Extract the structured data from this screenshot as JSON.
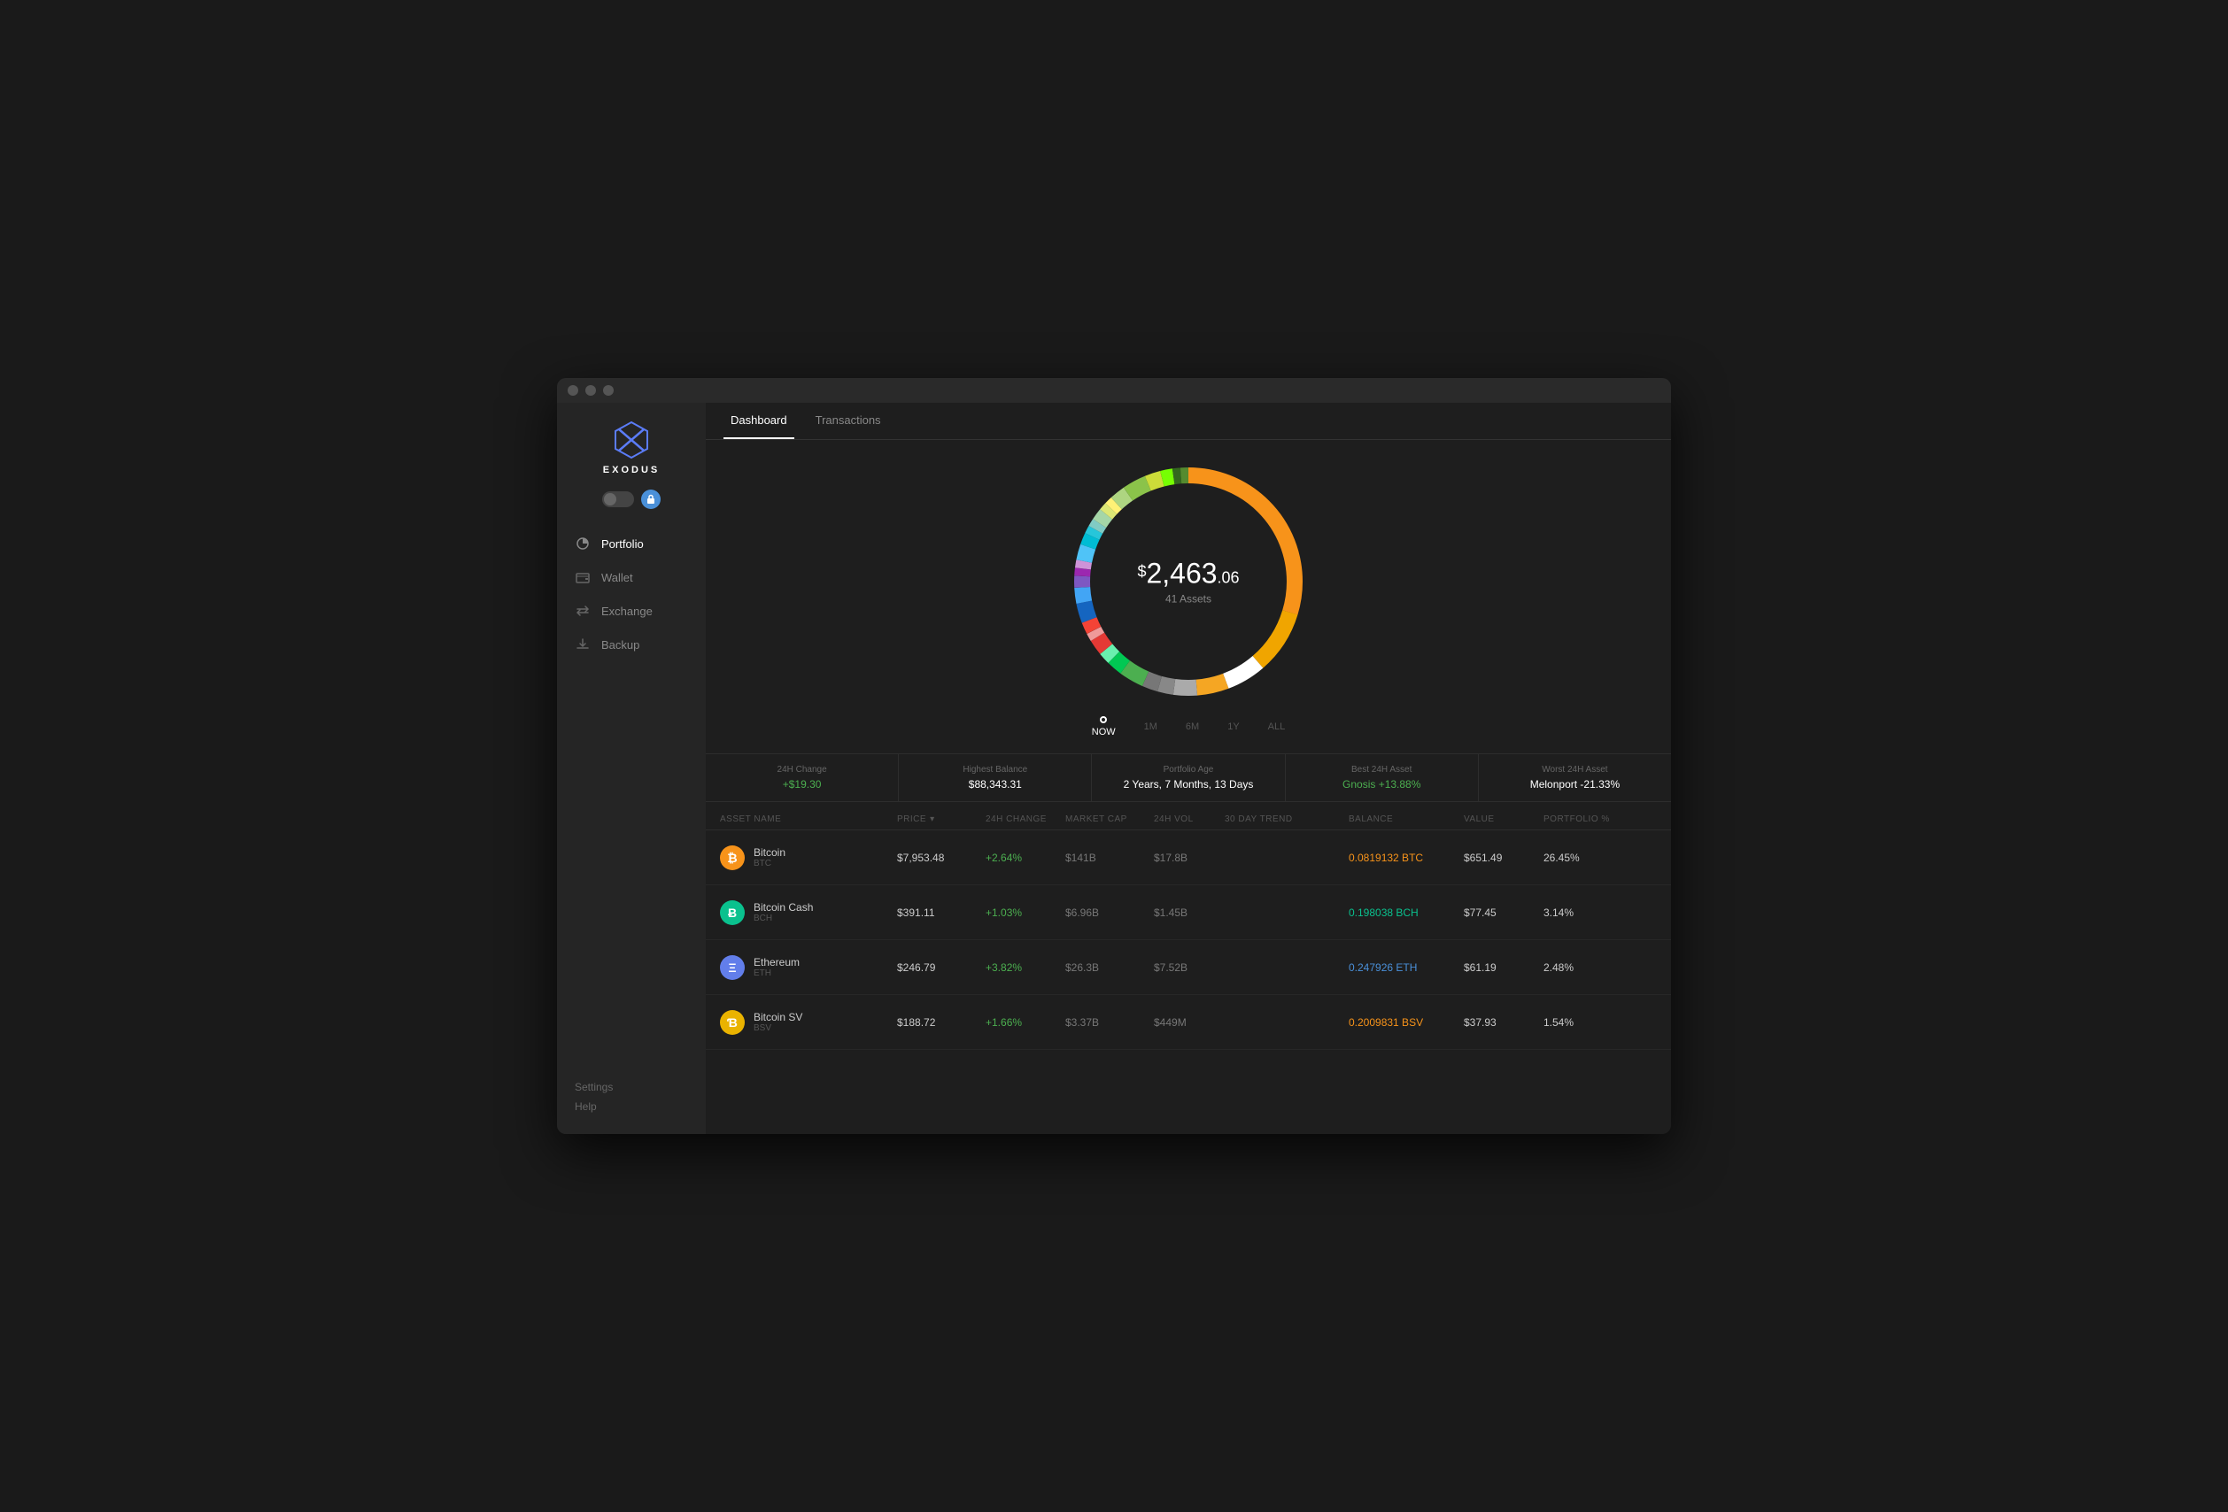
{
  "app": {
    "title": "EXODUS"
  },
  "tabs": [
    {
      "id": "dashboard",
      "label": "Dashboard",
      "active": true
    },
    {
      "id": "transactions",
      "label": "Transactions",
      "active": false
    }
  ],
  "sidebar": {
    "nav_items": [
      {
        "id": "portfolio",
        "label": "Portfolio",
        "active": true,
        "icon": "pie-chart-icon"
      },
      {
        "id": "wallet",
        "label": "Wallet",
        "active": false,
        "icon": "wallet-icon"
      },
      {
        "id": "exchange",
        "label": "Exchange",
        "active": false,
        "icon": "exchange-icon"
      },
      {
        "id": "backup",
        "label": "Backup",
        "active": false,
        "icon": "backup-icon"
      }
    ],
    "settings_label": "Settings",
    "help_label": "Help"
  },
  "portfolio": {
    "total_value": "2,463",
    "total_cents": ".06",
    "dollar_sign": "$",
    "assets_count": "41 Assets",
    "time_options": [
      {
        "id": "now",
        "label": "NOW",
        "active": true
      },
      {
        "id": "1m",
        "label": "1M",
        "active": false
      },
      {
        "id": "6m",
        "label": "6M",
        "active": false
      },
      {
        "id": "1y",
        "label": "1Y",
        "active": false
      },
      {
        "id": "all",
        "label": "ALL",
        "active": false
      }
    ]
  },
  "stats": [
    {
      "label": "24H Change",
      "value": "+$19.30",
      "positive": true
    },
    {
      "label": "Highest Balance",
      "value": "$88,343.31",
      "positive": false
    },
    {
      "label": "Portfolio Age",
      "value": "2 Years, 7 Months, 13 Days",
      "positive": false
    },
    {
      "label": "Best 24H Asset",
      "value": "Gnosis +13.88%",
      "positive": true
    },
    {
      "label": "Worst 24H Asset",
      "value": "Melonport -21.33%",
      "positive": false
    }
  ],
  "table_headers": [
    {
      "id": "name",
      "label": "ASSET NAME"
    },
    {
      "id": "price",
      "label": "PRICE",
      "sortable": true
    },
    {
      "id": "change",
      "label": "24H CHANGE"
    },
    {
      "id": "market_cap",
      "label": "MARKET CAP"
    },
    {
      "id": "vol",
      "label": "24H VOL"
    },
    {
      "id": "trend",
      "label": "30 DAY TREND"
    },
    {
      "id": "balance",
      "label": "BALANCE"
    },
    {
      "id": "value",
      "label": "VALUE"
    },
    {
      "id": "portfolio",
      "label": "PORTFOLIO %"
    }
  ],
  "assets": [
    {
      "name": "Bitcoin",
      "ticker": "BTC",
      "price": "$7,953.48",
      "change": "+2.64%",
      "change_positive": true,
      "market_cap": "$141B",
      "vol": "$17.8B",
      "balance": "0.0819132 BTC",
      "balance_color": "orange",
      "value": "$651.49",
      "portfolio": "26.45%",
      "icon_color": "#f7931a",
      "icon_letter": "₿"
    },
    {
      "name": "Bitcoin Cash",
      "ticker": "BCH",
      "price": "$391.11",
      "change": "+1.03%",
      "change_positive": true,
      "market_cap": "$6.96B",
      "vol": "$1.45B",
      "balance": "0.198038 BCH",
      "balance_color": "green",
      "value": "$77.45",
      "portfolio": "3.14%",
      "icon_color": "#0ac18e",
      "icon_letter": "Ƀ"
    },
    {
      "name": "Ethereum",
      "ticker": "ETH",
      "price": "$246.79",
      "change": "+3.82%",
      "change_positive": true,
      "market_cap": "$26.3B",
      "vol": "$7.52B",
      "balance": "0.247926 ETH",
      "balance_color": "blue",
      "value": "$61.19",
      "portfolio": "2.48%",
      "icon_color": "#627eea",
      "icon_letter": "Ξ"
    },
    {
      "name": "Bitcoin SV",
      "ticker": "BSV",
      "price": "$188.72",
      "change": "+1.66%",
      "change_positive": true,
      "market_cap": "$3.37B",
      "vol": "$449M",
      "balance": "0.2009831 BSV",
      "balance_color": "orange",
      "value": "$37.93",
      "portfolio": "1.54%",
      "icon_color": "#eab300",
      "icon_letter": "Ɓ"
    }
  ],
  "donut_segments": [
    {
      "color": "#f7931a",
      "percent": 26.45
    },
    {
      "color": "#f0a500",
      "percent": 8
    },
    {
      "color": "#ffffff",
      "percent": 5
    },
    {
      "color": "#f5a623",
      "percent": 4
    },
    {
      "color": "#aaaaaa",
      "percent": 3
    },
    {
      "color": "#888888",
      "percent": 2
    },
    {
      "color": "#777777",
      "percent": 2
    },
    {
      "color": "#4caf50",
      "percent": 3.14
    },
    {
      "color": "#00c853",
      "percent": 2
    },
    {
      "color": "#69f0ae",
      "percent": 1.5
    },
    {
      "color": "#e53935",
      "percent": 2
    },
    {
      "color": "#ef9a9a",
      "percent": 1
    },
    {
      "color": "#f44336",
      "percent": 1.5
    },
    {
      "color": "#1565c0",
      "percent": 2.48
    },
    {
      "color": "#42a5f5",
      "percent": 2
    },
    {
      "color": "#7e57c2",
      "percent": 1.5
    },
    {
      "color": "#9c27b0",
      "percent": 1
    },
    {
      "color": "#ce93d8",
      "percent": 1
    },
    {
      "color": "#4fc3f7",
      "percent": 2
    },
    {
      "color": "#00bcd4",
      "percent": 1.5
    },
    {
      "color": "#26c6da",
      "percent": 1
    },
    {
      "color": "#80cbc4",
      "percent": 1
    },
    {
      "color": "#a5d6a7",
      "percent": 1.5
    },
    {
      "color": "#dce775",
      "percent": 1
    },
    {
      "color": "#fff176",
      "percent": 1
    },
    {
      "color": "#aed581",
      "percent": 2
    },
    {
      "color": "#8bc34a",
      "percent": 3
    },
    {
      "color": "#cddc39",
      "percent": 2
    },
    {
      "color": "#76ff03",
      "percent": 1.54
    },
    {
      "color": "#33691e",
      "percent": 1
    },
    {
      "color": "#558b2f",
      "percent": 1
    }
  ]
}
